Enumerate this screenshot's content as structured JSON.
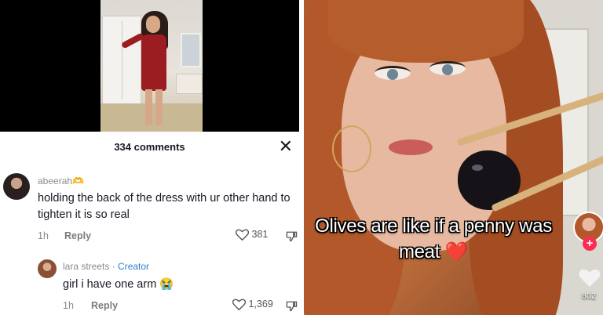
{
  "left_panel": {
    "comments_header": {
      "count_label": "334 comments",
      "close_icon": "✕"
    },
    "comments": [
      {
        "username": "abeerah",
        "username_emoji": "🫶",
        "text": "holding the back of the dress with ur other hand to tighten it is so real",
        "time": "1h",
        "reply_label": "Reply",
        "likes": "381"
      },
      {
        "username": "lara streets",
        "creator_badge": "· Creator",
        "text": "girl i have one arm 😭",
        "time": "1h",
        "reply_label": "Reply",
        "likes": "1,369"
      }
    ]
  },
  "right_panel": {
    "caption_text": "Olives are like if a penny was meat",
    "caption_emoji": "❤️",
    "follow_button_label": "+",
    "like_count": "802"
  },
  "colors": {
    "text_dark": "#161823",
    "text_muted": "#8a8b91",
    "creator_blue": "#2f7fc8",
    "follow_red": "#fe2c55"
  },
  "icons": [
    "close-icon",
    "heart-outline-icon",
    "dislike-icon",
    "heart-icon",
    "plus-icon"
  ]
}
